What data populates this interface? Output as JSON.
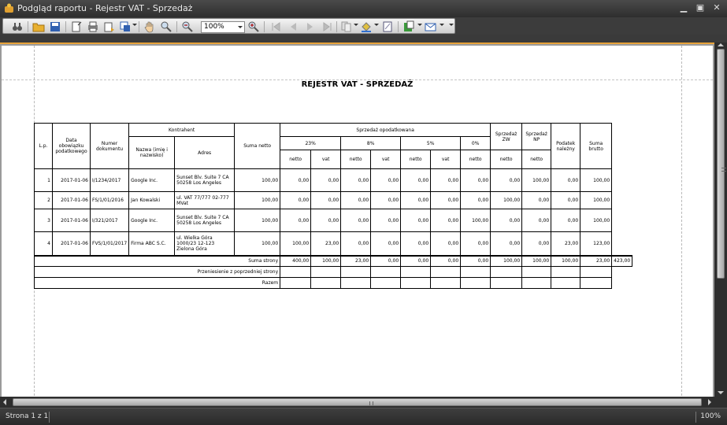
{
  "window": {
    "title": "Podgląd raportu - Rejestr VAT - Sprzedaż"
  },
  "toolbar": {
    "zoom_value": "100%",
    "icons": [
      "find-icon",
      "open-icon",
      "save-icon",
      "page-setup-icon",
      "print-icon",
      "quick-print-icon",
      "scale-icon",
      "hand-tool-icon",
      "magnifier-icon",
      "zoom-out-icon",
      "zoom-in-icon",
      "first-page-icon",
      "previous-page-icon",
      "next-page-icon",
      "last-page-icon",
      "multiple-pages-icon",
      "background-color-icon",
      "watermark-icon",
      "export-icon",
      "send-email-icon"
    ]
  },
  "report": {
    "title": "REJESTR VAT - SPRZEDAŻ",
    "headers": {
      "lp": "L.p.",
      "data": "Data obowiązku podatkowego",
      "numer": "Numer dokumentu",
      "kontrahent": "Kontrahent",
      "nazwa": "Nazwa (imię i nazwisko)",
      "adres": "Adres",
      "suma_netto": "Suma netto",
      "sprzedaz_opodatkowana": "Sprzedaż opodatkowana",
      "r23": "23%",
      "r8": "8%",
      "r5": "5%",
      "r0": "0%",
      "netto": "netto",
      "vat": "vat",
      "sprzedaz_zw": "Sprzedaż ZW",
      "sprzedaz_np": "Sprzedaż NP",
      "podatek": "Podatek należny",
      "suma_brutto": "Suma brutto"
    },
    "rows": [
      {
        "lp": "1",
        "data": "2017-01-06",
        "numer": "I/1234/2017",
        "nazwa": "Google Inc.",
        "adres": "Sunset Blv. Suite 7 CA 50258 Los Angeles",
        "suma_netto": "100,00",
        "n23": "0,00",
        "v23": "0,00",
        "n8": "0,00",
        "v8": "0,00",
        "n5": "0,00",
        "v5": "0,00",
        "n0": "0,00",
        "zw": "0,00",
        "np": "100,00",
        "podatek": "0,00",
        "brutto": "100,00"
      },
      {
        "lp": "2",
        "data": "2017-01-06",
        "numer": "FS/1/01/2016",
        "nazwa": "Jan Kowalski",
        "adres": "ul. VAT 77/777 02-777 MVat",
        "suma_netto": "100,00",
        "n23": "0,00",
        "v23": "0,00",
        "n8": "0,00",
        "v8": "0,00",
        "n5": "0,00",
        "v5": "0,00",
        "n0": "0,00",
        "zw": "100,00",
        "np": "0,00",
        "podatek": "0,00",
        "brutto": "100,00"
      },
      {
        "lp": "3",
        "data": "2017-01-06",
        "numer": "I/321/2017",
        "nazwa": "Google Inc.",
        "adres": "Sunset Blv. Suite 7 CA 50258 Los Angeles",
        "suma_netto": "100,00",
        "n23": "0,00",
        "v23": "0,00",
        "n8": "0,00",
        "v8": "0,00",
        "n5": "0,00",
        "v5": "0,00",
        "n0": "100,00",
        "zw": "0,00",
        "np": "0,00",
        "podatek": "0,00",
        "brutto": "100,00"
      },
      {
        "lp": "4",
        "data": "2017-01-06",
        "numer": "FVS/1/01/2017",
        "nazwa": "Firma ABC S.C.",
        "adres": "ul. Wielka Góra 1000/23 12-123 Zielona Góra",
        "suma_netto": "100,00",
        "n23": "100,00",
        "v23": "23,00",
        "n8": "0,00",
        "v8": "0,00",
        "n5": "0,00",
        "v5": "0,00",
        "n0": "0,00",
        "zw": "0,00",
        "np": "0,00",
        "podatek": "23,00",
        "brutto": "123,00"
      }
    ],
    "totals": {
      "label": "Suma strony",
      "suma_netto": "400,00",
      "n23": "100,00",
      "v23": "23,00",
      "n8": "0,00",
      "v8": "0,00",
      "n5": "0,00",
      "v5": "0,00",
      "n0": "100,00",
      "zw": "100,00",
      "np": "100,00",
      "podatek": "23,00",
      "brutto": "423,00"
    },
    "carried_label": "Przeniesienie z poprzedniej strony",
    "razem_label": "Razem"
  },
  "status": {
    "page": "Strona 1 z 1",
    "zoom": "100%"
  }
}
